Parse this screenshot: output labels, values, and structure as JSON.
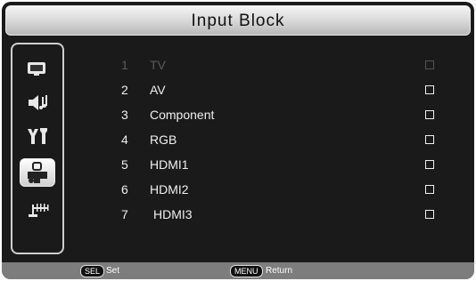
{
  "window": {
    "title": "Input Block"
  },
  "sidebar": {
    "items": [
      {
        "icon": "picture-icon"
      },
      {
        "icon": "sound-icon"
      },
      {
        "icon": "setup-tools-icon"
      },
      {
        "icon": "lock-settings-icon",
        "selected": true
      },
      {
        "icon": "channel-antenna-icon"
      }
    ]
  },
  "inputs": [
    {
      "num": "1",
      "label": "TV",
      "disabled": true
    },
    {
      "num": "2",
      "label": "AV"
    },
    {
      "num": "3",
      "label": "Component"
    },
    {
      "num": "4",
      "label": "RGB"
    },
    {
      "num": "5",
      "label": "HDMI1"
    },
    {
      "num": "6",
      "label": "HDMI2"
    },
    {
      "num": "7",
      "label": "HDMI3"
    }
  ],
  "footer": {
    "sel_key": "SEL",
    "sel_action": "Set",
    "menu_key": "MENU",
    "menu_action": "Return"
  }
}
